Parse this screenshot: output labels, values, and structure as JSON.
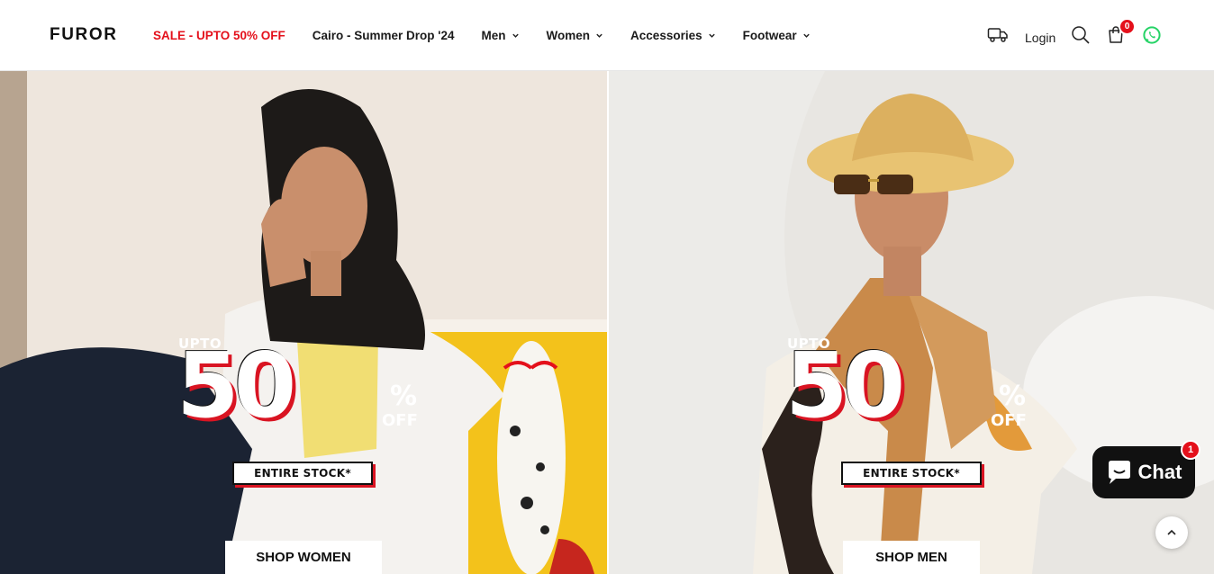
{
  "brand": {
    "logo": "FUROR"
  },
  "nav": {
    "items": [
      {
        "label": "SALE - UPTO 50% OFF",
        "dropdown": false,
        "highlight": true
      },
      {
        "label": "Cairo - Summer Drop '24",
        "dropdown": false
      },
      {
        "label": "Men",
        "dropdown": true
      },
      {
        "label": "Women",
        "dropdown": true
      },
      {
        "label": "Accessories",
        "dropdown": true
      },
      {
        "label": "Footwear",
        "dropdown": true
      }
    ]
  },
  "header_actions": {
    "login": "Login",
    "cart_count": "0",
    "icons": [
      "truck-icon",
      "search-icon",
      "cart-icon",
      "whatsapp-icon"
    ]
  },
  "hero": {
    "left": {
      "promo": {
        "upto": "UPTO",
        "percent": "50",
        "percent_sign": "%",
        "off": "OFF",
        "stock": "ENTIRE STOCK*"
      },
      "button": "SHOP WOMEN"
    },
    "right": {
      "promo": {
        "upto": "UPTO",
        "percent": "50",
        "percent_sign": "%",
        "off": "OFF",
        "stock": "ENTIRE STOCK*"
      },
      "button": "SHOP MEN"
    }
  },
  "chat": {
    "label": "Chat",
    "unread": "1"
  },
  "colors": {
    "sale": "#e4101b",
    "accent_red": "#d91422",
    "chat_bg": "#111111",
    "whatsapp": "#25d366"
  }
}
